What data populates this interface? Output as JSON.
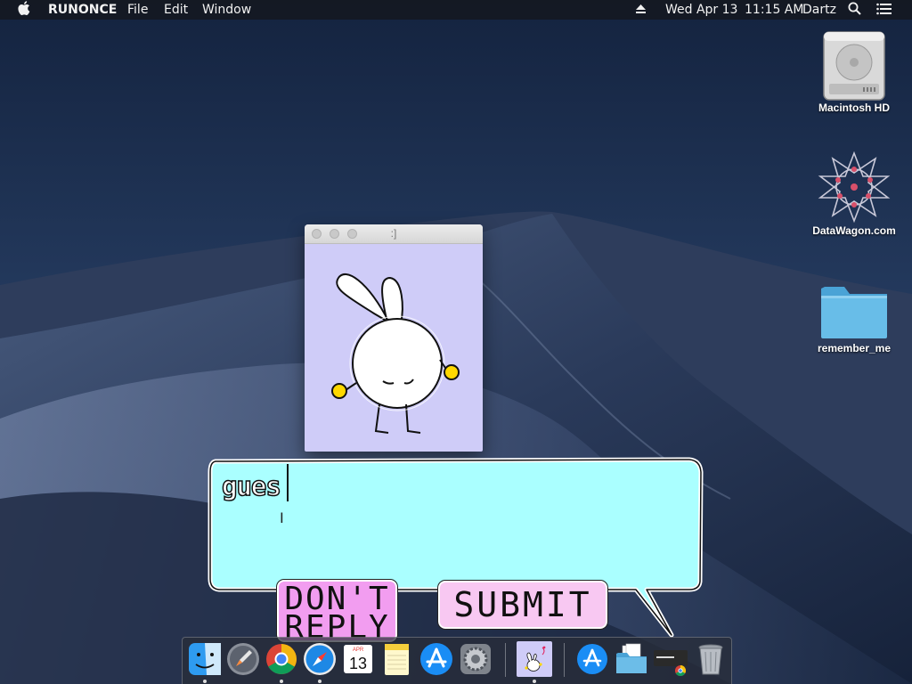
{
  "menubar": {
    "apple_icon": "apple-icon",
    "app_name": "RUNONCE",
    "menus": [
      "File",
      "Edit",
      "Window"
    ],
    "date": "Wed Apr 13",
    "time": "11:15 AM",
    "user": "Dartz",
    "status_icons": [
      "eject-icon",
      "search-icon",
      "menu-list-icon"
    ]
  },
  "desktop": {
    "icons": [
      {
        "label": "Macintosh HD",
        "icon": "hard-drive-icon"
      },
      {
        "label": "DataWagon.com",
        "icon": "star-mandala-icon"
      },
      {
        "label": "remember_me",
        "icon": "folder-icon"
      }
    ]
  },
  "window": {
    "title": ":]",
    "background": "#cfccf8",
    "character": "bunny-icon"
  },
  "bubble": {
    "input_value": "gues",
    "background": "#aaffff"
  },
  "buttons": {
    "dont_reply_line1": "DON'T",
    "dont_reply_line2": "REPLY",
    "submit": "SUBMIT",
    "dont_reply_color": "#f29df0",
    "submit_color": "#f8c8f2"
  },
  "dock": {
    "items": [
      {
        "name": "Finder",
        "icon": "finder-icon"
      },
      {
        "name": "Launchpad",
        "icon": "launchpad-icon"
      },
      {
        "name": "Chrome",
        "icon": "chrome-icon"
      },
      {
        "name": "Safari",
        "icon": "safari-icon"
      },
      {
        "name": "Calendar",
        "icon": "calendar-icon",
        "month": "APR",
        "day": "13"
      },
      {
        "name": "Notes",
        "icon": "notes-icon"
      },
      {
        "name": "App Store",
        "icon": "app-store-icon"
      },
      {
        "name": "System Preferences",
        "icon": "system-preferences-icon"
      },
      {
        "name": "RUNONCE",
        "icon": "bunny-app-icon"
      },
      {
        "name": "Applications",
        "icon": "applications-folder-icon"
      },
      {
        "name": "Documents",
        "icon": "documents-folder-icon"
      },
      {
        "name": "Chrome Apps",
        "icon": "chrome-apps-icon"
      },
      {
        "name": "Trash",
        "icon": "trash-icon"
      }
    ]
  }
}
